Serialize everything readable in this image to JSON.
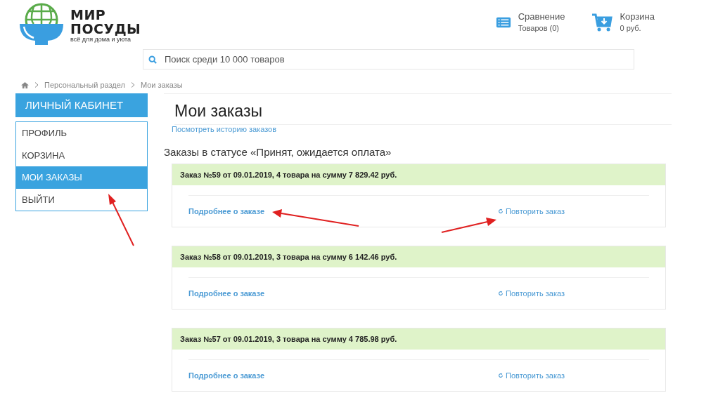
{
  "logo": {
    "line_1": "МИР",
    "line_2": "ПОСУДЫ",
    "tagline": "всё для дома и уюта"
  },
  "header_links": [
    {
      "kind": "compare",
      "title": "Сравнение",
      "subtitle": "Товаров (0)"
    },
    {
      "kind": "cart",
      "title": "Корзина",
      "subtitle": "0 руб."
    }
  ],
  "search": {
    "placeholder": "Поиск среди 10 000 товаров"
  },
  "breadcrumbs": [
    "Персональный раздел",
    "Мои заказы"
  ],
  "sidebar": {
    "title": "ЛИЧНЫЙ КАБИНЕТ",
    "items": [
      {
        "label": "ПРОФИЛЬ",
        "selected": false
      },
      {
        "label": "КОРЗИНА",
        "selected": false
      },
      {
        "label": "МОИ ЗАКАЗЫ",
        "selected": true
      },
      {
        "label": "ВЫЙТИ",
        "selected": false
      }
    ]
  },
  "page_title": "Мои заказы",
  "history_link": "Посмотреть историю заказов",
  "status_heading": "Заказы в статусе «Принят, ожидается оплата»",
  "orders": [
    {
      "title": "Заказ №59 от 09.01.2019, 4 товара на сумму 7 829.42 руб.",
      "details": "Подробнее о заказе",
      "repeat": "Повторить заказ"
    },
    {
      "title": "Заказ №58 от 09.01.2019, 3 товара на сумму 6 142.46 руб.",
      "details": "Подробнее о заказе",
      "repeat": "Повторить заказ"
    },
    {
      "title": "Заказ №57 от 09.01.2019, 3 товара на сумму 4 785.98 руб.",
      "details": "Подробнее о заказе",
      "repeat": "Повторить заказ"
    }
  ]
}
